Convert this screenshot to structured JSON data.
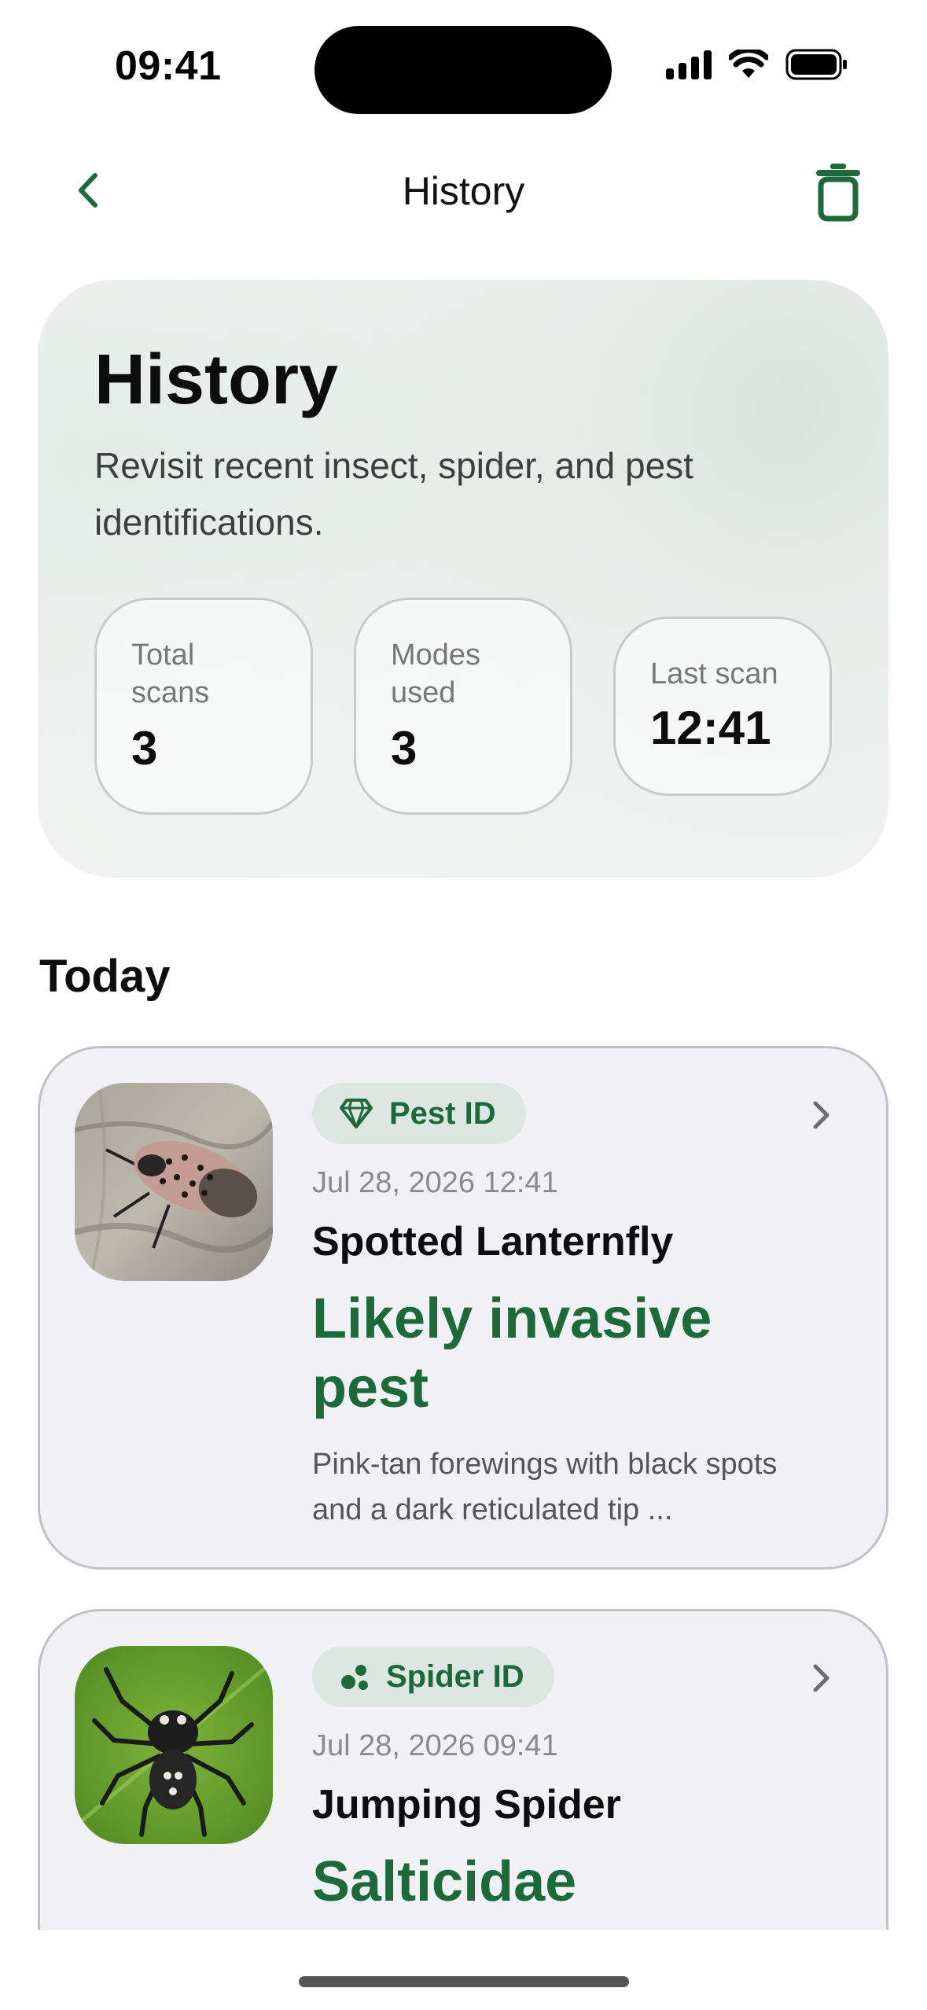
{
  "status_bar": {
    "time": "09:41"
  },
  "nav": {
    "title": "History",
    "back_icon": "chevron-left-icon",
    "trash_icon": "trash-icon"
  },
  "hero": {
    "title": "History",
    "subtitle": "Revisit recent insect, spider, and pest identifications.",
    "stats": [
      {
        "label": "Total scans",
        "value": "3"
      },
      {
        "label": "Modes used",
        "value": "3"
      },
      {
        "label": "Last scan",
        "value": "12:41"
      }
    ]
  },
  "section": {
    "title": "Today"
  },
  "items": [
    {
      "chip_icon": "diamond-icon",
      "chip": "Pest ID",
      "date": "Jul 28, 2026 12:41",
      "name": "Spotted Lanternfly",
      "verdict": "Likely invasive pest",
      "description": "Pink-tan forewings with black spots and a dark reticulated tip ..."
    },
    {
      "chip_icon": "spider-dots-icon",
      "chip": "Spider ID",
      "date": "Jul 28, 2026 09:41",
      "name": "Jumping Spider",
      "verdict": "Salticidae"
    }
  ],
  "colors": {
    "accent": "#1c6a3a",
    "chip_bg": "#dde6e1",
    "card_bg": "#f1f1f5"
  }
}
